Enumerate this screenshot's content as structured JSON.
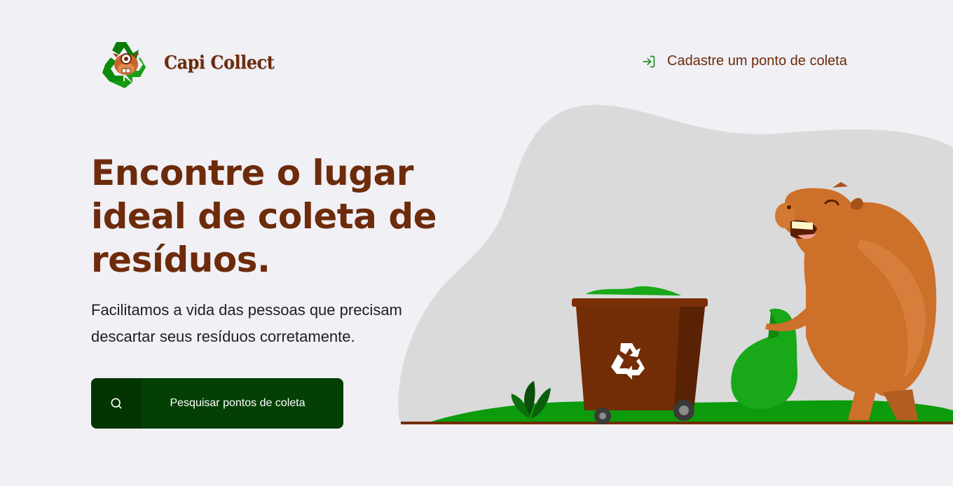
{
  "header": {
    "brand_name": "Capi Collect",
    "logo_icon": "recycle-capybara-logo",
    "register_link": {
      "label": "Cadastre um ponto de coleta",
      "icon": "log-in-icon"
    }
  },
  "hero": {
    "title": "Encontre o lugar ideal de coleta de resíduos.",
    "description": "Facilitamos a vida das pessoas que precisam descartar seus resíduos corretamente.",
    "search_button": {
      "label": "Pesquisar pontos de coleta",
      "icon": "search-icon"
    }
  },
  "illustration": {
    "subject": "capybara-with-recycling-bin",
    "colors": {
      "blob": "#DADADA",
      "grass": "#0C9B0C",
      "bin": "#722D07",
      "capybara": "#CC702A"
    }
  },
  "colors": {
    "background": "#F0F0F5",
    "primary_text": "#6D2B0B",
    "button": "#044004",
    "accent_green": "#1E8E1E"
  }
}
